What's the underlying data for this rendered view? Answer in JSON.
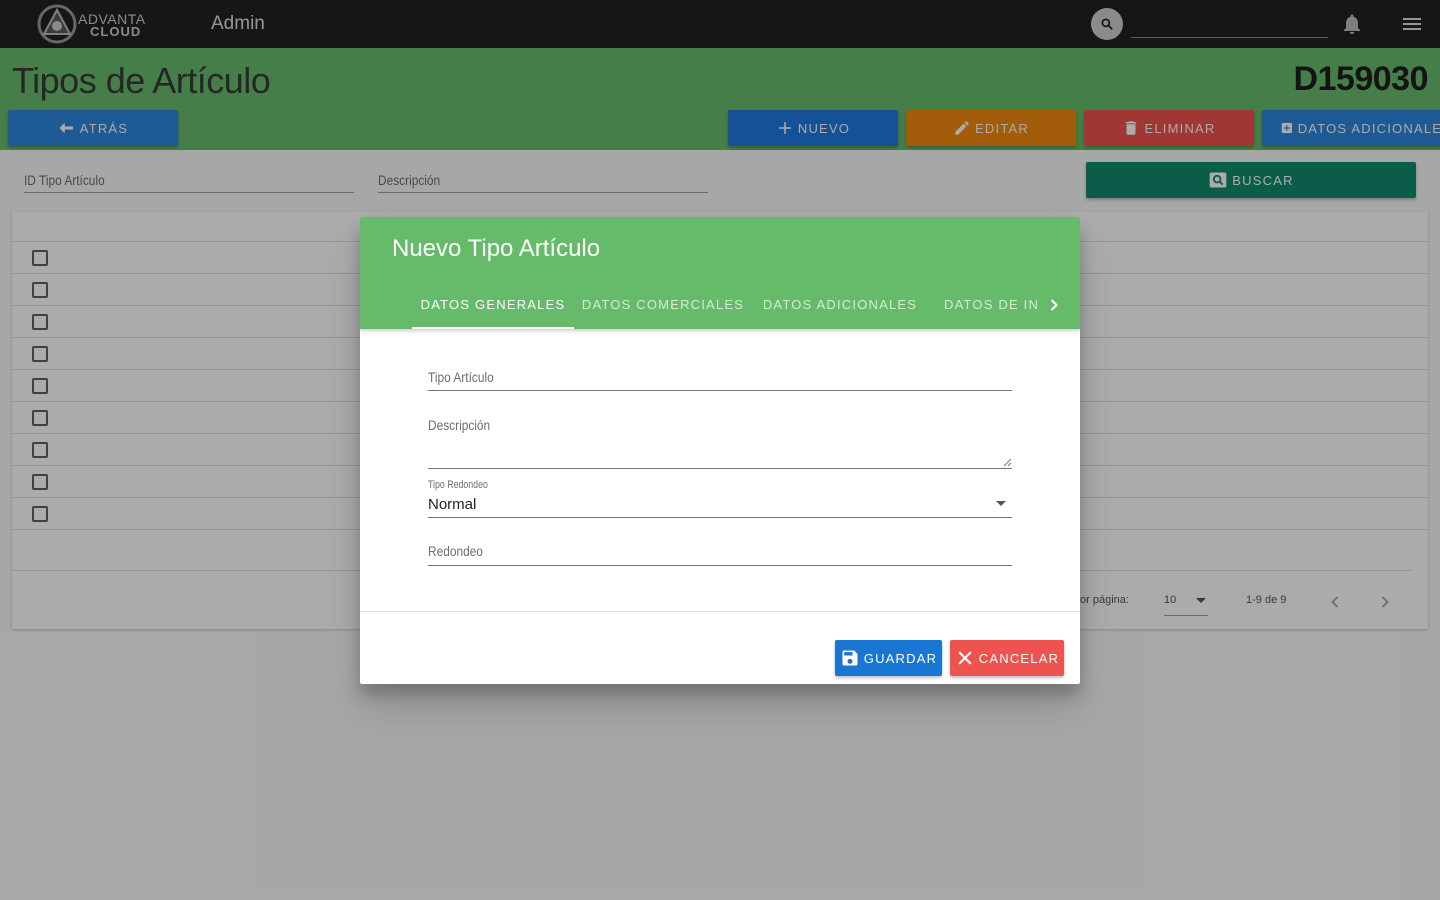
{
  "topbar": {
    "logo_line1": "ADVANTA",
    "logo_line2": "CLOUD",
    "admin_label": "Admin",
    "search_value": ""
  },
  "page": {
    "title": "Tipos de Artículo",
    "code": "D159030"
  },
  "actions": {
    "back": "ATRÁS",
    "new": "NUEVO",
    "edit": "EDITAR",
    "delete": "ELIMINAR",
    "extra": "DATOS ADICIONALES",
    "search": "BUSCAR"
  },
  "filters": {
    "id_label": "ID Tipo Artículo",
    "desc_label": "Descripción"
  },
  "table": {
    "row_count": 9,
    "rows_per_page_label": "or página:",
    "rows_per_page_value": "10",
    "range_label": "1-9 de 9"
  },
  "dialog": {
    "title": "Nuevo Tipo Artículo",
    "tabs": [
      {
        "label": "DATOS GENERALES",
        "active": true
      },
      {
        "label": "DATOS COMERCIALES",
        "active": false
      },
      {
        "label": "DATOS ADICIONALES",
        "active": false
      },
      {
        "label": "DATOS DE IN",
        "active": false
      }
    ],
    "fields": {
      "tipo_articulo_label": "Tipo Artículo",
      "descripcion_label": "Descripción",
      "tipo_redondeo_label": "Tipo Redondeo",
      "tipo_redondeo_value": "Normal",
      "redondeo_label": "Redondeo"
    },
    "save": "GUARDAR",
    "cancel": "CANCELAR"
  },
  "colors": {
    "topbar": "#212121",
    "header_green": "#69bd6d",
    "dialog_green": "#66bb6a",
    "primary_blue": "#1f7ae0",
    "edit_orange": "#f28a0f",
    "delete_red": "#ef5350",
    "search_teal": "#128a6f"
  },
  "icons": [
    "search-icon",
    "bell-icon",
    "menu-icon",
    "arrow-left-icon",
    "plus-icon",
    "pencil-icon",
    "trash-icon",
    "plus-box-icon",
    "magnify-box-icon",
    "chevron-right-icon",
    "chevron-left-icon",
    "floppy-icon",
    "close-icon"
  ]
}
